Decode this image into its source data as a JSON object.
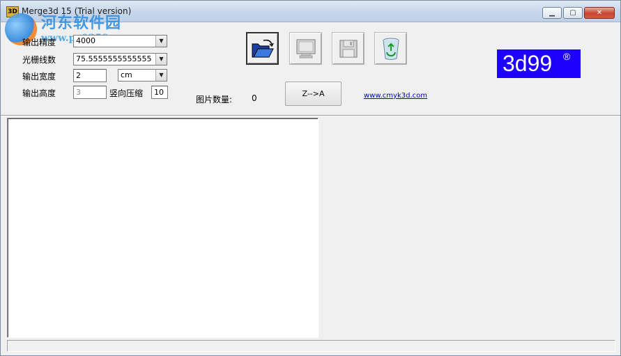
{
  "window": {
    "title": "Merge3d 15  (Trial version)",
    "icon": "merge3d-app-icon",
    "icon_text": "3D"
  },
  "watermark": {
    "title": "河东软件园",
    "url": "www.pc0359.cn"
  },
  "window_controls": {
    "minimize": "▁",
    "maximize": "▢",
    "close": "✕"
  },
  "fields": {
    "output_precision": {
      "label": "输出精度",
      "value": "4000"
    },
    "raster_lines": {
      "label": "光栅线数",
      "value": "75.5555555555555"
    },
    "output_width": {
      "label": "输出宽度",
      "value": "2",
      "unit": "cm"
    },
    "output_height": {
      "label": "输出高度",
      "value": "3"
    },
    "vertical_compress": {
      "label": "竖向压缩",
      "value": "10"
    }
  },
  "image_count": {
    "label": "图片数量:",
    "value": "0"
  },
  "buttons": {
    "sort": "Z-->A"
  },
  "toolbar_icons": [
    "open-folder-icon",
    "monitor-icon",
    "floppy-save-icon",
    "recycle-bin-icon"
  ],
  "link": "www.cmyk3d.com",
  "brand": {
    "name": "3d99",
    "mark": "®",
    "bg": "#1e00ff"
  }
}
